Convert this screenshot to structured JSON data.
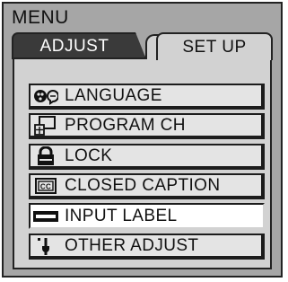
{
  "menu": {
    "title": "MENU"
  },
  "tabs": [
    {
      "label": "ADJUST",
      "active": false
    },
    {
      "label": "SET UP",
      "active": true
    }
  ],
  "items": [
    {
      "label": "LANGUAGE",
      "icon": "language-icon"
    },
    {
      "label": "PROGRAM CH",
      "icon": "program-channel-icon"
    },
    {
      "label": "LOCK",
      "icon": "lock-icon"
    },
    {
      "label": "CLOSED CAPTION",
      "icon": "closed-caption-icon"
    },
    {
      "label": "INPUT LABEL",
      "icon": "input-label-icon",
      "selected": true
    },
    {
      "label": "OTHER ADJUST",
      "icon": "other-adjust-icon"
    }
  ],
  "cc_badge": "CC",
  "colors": {
    "background": "#a6a6a6",
    "panel": "#d2d2d2",
    "active_tab": "#3a3a3a",
    "selected_item": "#ffffff"
  }
}
